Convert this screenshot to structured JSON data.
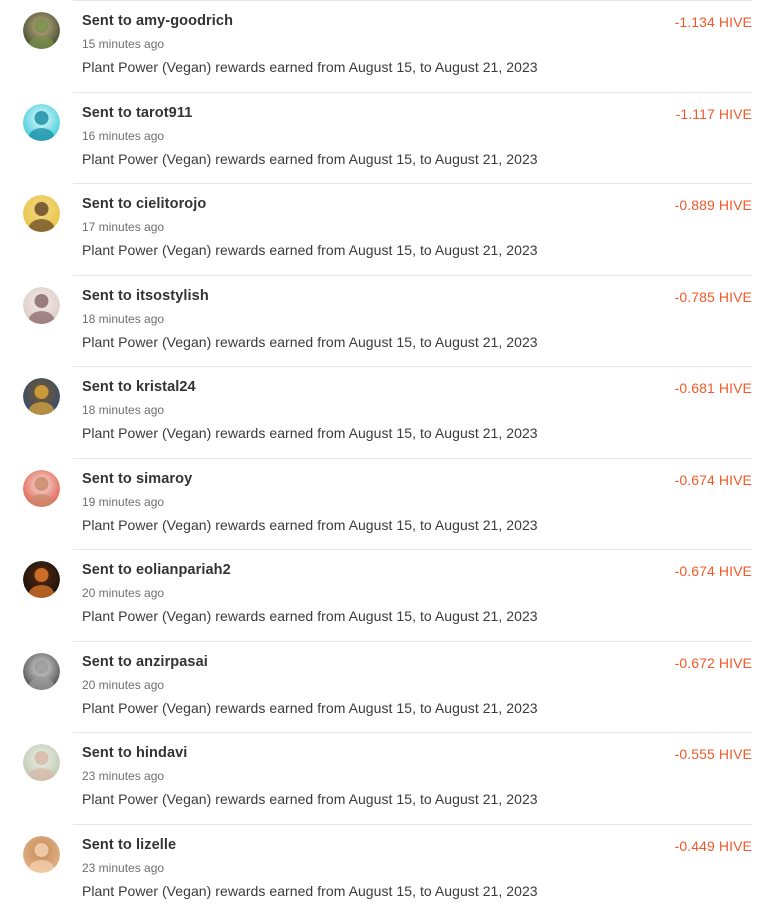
{
  "transfers": [
    {
      "title": "Sent to amy-goodrich",
      "time": "15 minutes ago",
      "memo": "Plant Power (Vegan) rewards earned from August 15, to August 21, 2023",
      "amount": "-1.134 HIVE",
      "avatar_icon": "avatar-amy-goodrich-icon",
      "avatar_colors": [
        "#2d3b1f",
        "#7a8f4a",
        "#c9b48a"
      ]
    },
    {
      "title": "Sent to tarot911",
      "time": "16 minutes ago",
      "memo": "Plant Power (Vegan) rewards earned from August 15, to August 21, 2023",
      "amount": "-1.117 HIVE",
      "avatar_icon": "avatar-tarot911-icon",
      "avatar_colors": [
        "#27c7d8",
        "#1b8fa6",
        "#e8f9fb"
      ]
    },
    {
      "title": "Sent to cielitorojo",
      "time": "17 minutes ago",
      "memo": "Plant Power (Vegan) rewards earned from August 15, to August 21, 2023",
      "amount": "-0.889 HIVE",
      "avatar_icon": "avatar-cielitorojo-icon",
      "avatar_colors": [
        "#e8c13a",
        "#6b4a2a",
        "#f2d98a"
      ]
    },
    {
      "title": "Sent to itsostylish",
      "time": "18 minutes ago",
      "memo": "Plant Power (Vegan) rewards earned from August 15, to August 21, 2023",
      "amount": "-0.785 HIVE",
      "avatar_icon": "avatar-itsostylish-icon",
      "avatar_colors": [
        "#d9c7c1",
        "#8a6a6a",
        "#f3ebe8"
      ]
    },
    {
      "title": "Sent to kristal24",
      "time": "18 minutes ago",
      "memo": "Plant Power (Vegan) rewards earned from August 15, to August 21, 2023",
      "amount": "-0.681 HIVE",
      "avatar_icon": "avatar-kristal24-icon",
      "avatar_colors": [
        "#2a4a7a",
        "#d9a43a",
        "#7a5a2a"
      ]
    },
    {
      "title": "Sent to simaroy",
      "time": "19 minutes ago",
      "memo": "Plant Power (Vegan) rewards earned from August 15, to August 21, 2023",
      "amount": "-0.674 HIVE",
      "avatar_icon": "avatar-simaroy-icon",
      "avatar_colors": [
        "#e04a3a",
        "#c98a6a",
        "#f4e6e0"
      ]
    },
    {
      "title": "Sent to eolianpariah2",
      "time": "20 minutes ago",
      "memo": "Plant Power (Vegan) rewards earned from August 15, to August 21, 2023",
      "amount": "-0.674 HIVE",
      "avatar_icon": "avatar-eolianpariah2-icon",
      "avatar_colors": [
        "#0d0d0d",
        "#e07a2a",
        "#5a2a10"
      ]
    },
    {
      "title": "Sent to anzirpasai",
      "time": "20 minutes ago",
      "memo": "Plant Power (Vegan) rewards earned from August 15, to August 21, 2023",
      "amount": "-0.672 HIVE",
      "avatar_icon": "avatar-anzirpasai-icon",
      "avatar_colors": [
        "#3a3a3a",
        "#9a9a9a",
        "#e0e0e0"
      ]
    },
    {
      "title": "Sent to hindavi",
      "time": "23 minutes ago",
      "memo": "Plant Power (Vegan) rewards earned from August 15, to August 21, 2023",
      "amount": "-0.555 HIVE",
      "avatar_icon": "avatar-hindavi-icon",
      "avatar_colors": [
        "#b8c4a8",
        "#d8b8a8",
        "#eef0ea"
      ]
    },
    {
      "title": "Sent to lizelle",
      "time": "23 minutes ago",
      "memo": "Plant Power (Vegan) rewards earned from August 15, to August 21, 2023",
      "amount": "-0.449 HIVE",
      "avatar_icon": "avatar-lizelle-icon",
      "avatar_colors": [
        "#e8b88a",
        "#f4d2b0",
        "#c48a5a"
      ]
    }
  ]
}
